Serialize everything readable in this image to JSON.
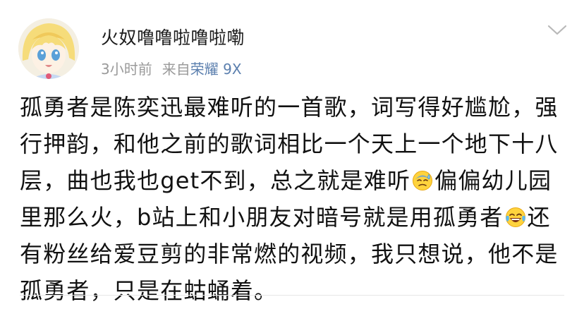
{
  "post": {
    "username": "火奴噜噜啦噜啦嘞",
    "time": "3小时前",
    "source_prefix": "来自",
    "device": "荣耀 9X",
    "content": {
      "line1": "孤勇者是陈奕迅最难听的一首歌，词写得好尴尬，强",
      "line2": "行押韵，和他之前的歌词相比一个天上一个地下十八",
      "line3a": "层，曲也我也get不到，总之就是难听",
      "line3b": "偏偏幼儿园",
      "line4a": "里那么火，b站上和小朋友对暗号就是用孤勇者",
      "line4b": "还",
      "line5": "有粉丝给爱豆剪的非常燃的视频，我只想说，他不是",
      "line6": "孤勇者，只是在蛄蛹着。"
    },
    "emojis": [
      "sweat-face-emoji",
      "laugh-cry-emoji"
    ]
  },
  "colors": {
    "link": "#5b7fae",
    "meta": "#9a9a9a",
    "text": "#111111"
  }
}
